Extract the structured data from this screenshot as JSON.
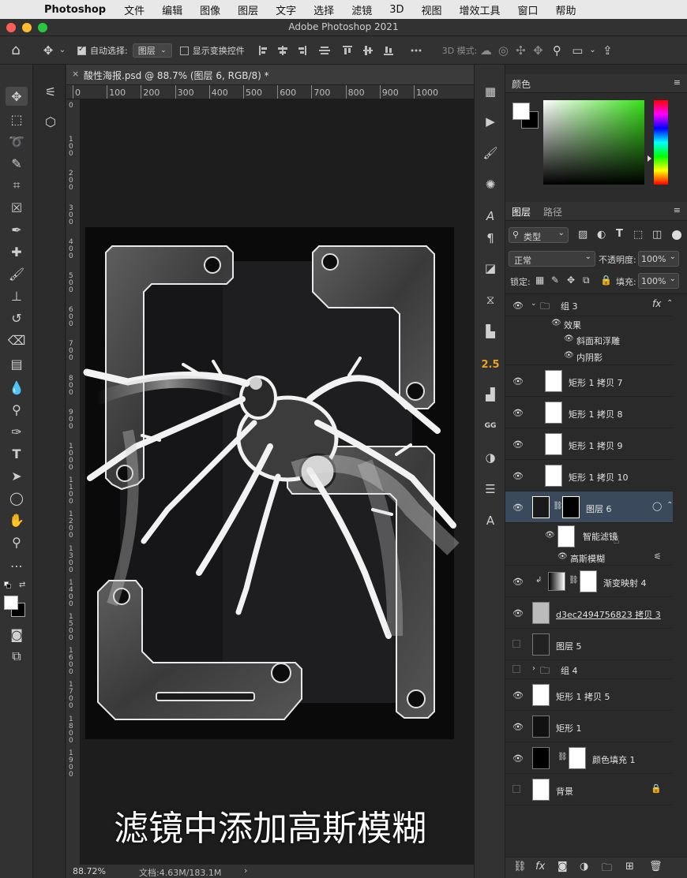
{
  "menubar": {
    "app_name": "Photoshop",
    "items": [
      "文件",
      "编辑",
      "图像",
      "图层",
      "文字",
      "选择",
      "滤镜",
      "3D",
      "视图",
      "增效工具",
      "窗口",
      "帮助"
    ]
  },
  "window": {
    "title": "Adobe Photoshop 2021"
  },
  "options_bar": {
    "auto_select_label": "自动选择:",
    "auto_select_value": "图层",
    "show_transform_label": "显示变换控件",
    "mode_3d_label": "3D 模式:"
  },
  "document": {
    "tab_title": "酸性海报.psd @ 88.7% (图层 6, RGB/8) *",
    "ruler_top": [
      "0",
      "100",
      "200",
      "300",
      "400",
      "500",
      "600",
      "700",
      "800",
      "900",
      "1000"
    ],
    "ruler_left": [
      "0",
      "100",
      "200",
      "300",
      "400",
      "500",
      "600",
      "700",
      "800",
      "900",
      "1000",
      "1100",
      "1200",
      "1300",
      "1400",
      "1500",
      "1600",
      "1700",
      "1800",
      "1900"
    ],
    "zoom": "88.72%",
    "doc_info": "文档:4.63M/183.1M",
    "caption": "滤镜中添加高斯模糊"
  },
  "side_icons": {
    "value_25": "2.5",
    "gg": "GG"
  },
  "color_panel": {
    "tab": "颜色",
    "foreground": "#ffffff",
    "background": "#000000",
    "picker_hue": "#39e11a"
  },
  "layers_panel": {
    "tabs": [
      "图层",
      "路径"
    ],
    "filter_label": "类型",
    "blend_mode": "正常",
    "opacity_label": "不透明度:",
    "opacity_value": "100%",
    "lock_label": "锁定:",
    "fill_label": "填充:",
    "fill_value": "100%",
    "group3": {
      "name": "组 3",
      "fx": "fx",
      "effects_label": "效果",
      "effects": [
        "斜面和浮雕",
        "内阴影"
      ]
    },
    "layers": [
      {
        "name": "矩形 1 拷贝 7"
      },
      {
        "name": "矩形 1 拷贝 8"
      },
      {
        "name": "矩形 1 拷贝 9"
      },
      {
        "name": "矩形 1 拷贝 10"
      },
      {
        "name": "图层 6"
      }
    ],
    "smart_filters": {
      "label": "智能滤镜",
      "filter": "高斯模糊"
    },
    "lower_layers": [
      {
        "name": "渐变映射 4"
      },
      {
        "name": "d3ec2494756823 拷贝 3"
      },
      {
        "name": "图层 5"
      },
      {
        "name": "组 4"
      },
      {
        "name": "矩形 1 拷贝 5"
      },
      {
        "name": "矩形 1"
      },
      {
        "name": "颜色填充 1"
      },
      {
        "name": "背景"
      }
    ]
  }
}
